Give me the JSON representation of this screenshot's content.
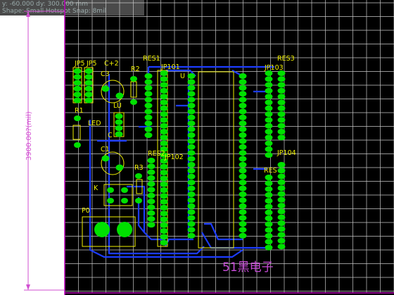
{
  "hud": {
    "line1": "y:  -60.000     dy:  300.000   mm",
    "line2": "Shape: Small Hotspot Snap: 8mil"
  },
  "dimension_label": "3900.00?(mil)",
  "watermark": "51黑电子",
  "components": {
    "jp5a": "JP5",
    "jp5b": "JP5",
    "c2": "C+2",
    "c3": "C3",
    "r2": "R2",
    "res1": "RES1",
    "jp101": "JP101",
    "u": "U",
    "res3": "RES3",
    "jp103": "JP103",
    "r1": "R1",
    "lu": "LU",
    "led": "LED",
    "c": "C",
    "c1": "C1",
    "res2": "RES2",
    "jp102": "JP102",
    "jp104": "JP104",
    "res": "RES",
    "r3": "R3",
    "k": "K",
    "p0": "P0"
  },
  "colors": {
    "background": "#000000",
    "grid": "#c8c8c8",
    "pad": "#00e000",
    "trace": "#1c3cff",
    "silkscreen": "#f0f000",
    "outline": "#c000c0",
    "dimension": "#d14fd1"
  }
}
